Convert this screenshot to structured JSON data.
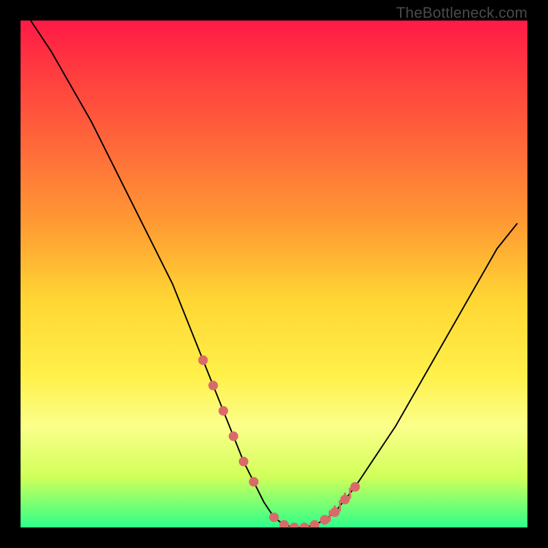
{
  "watermark": "TheBottleneck.com",
  "chart_data": {
    "type": "line",
    "title": "",
    "xlabel": "",
    "ylabel": "",
    "xlim": [
      0,
      100
    ],
    "ylim": [
      0,
      100
    ],
    "series": [
      {
        "name": "bottleneck-curve",
        "x": [
          2,
          6,
          10,
          14,
          18,
          22,
          26,
          30,
          34,
          36,
          38,
          40,
          42,
          44,
          46,
          48,
          50,
          52,
          54,
          56,
          58,
          60,
          62,
          66,
          70,
          74,
          78,
          82,
          86,
          90,
          94,
          98
        ],
        "y": [
          100,
          94,
          87,
          80,
          72,
          64,
          56,
          48,
          38,
          33,
          28,
          23,
          18,
          13,
          9,
          5,
          2,
          0.5,
          0,
          0,
          0.5,
          1.5,
          3,
          8,
          14,
          20,
          27,
          34,
          41,
          48,
          55,
          60
        ]
      }
    ],
    "markers": {
      "left_cluster_x": [
        36,
        38,
        40,
        42,
        44,
        46
      ],
      "left_cluster_y": [
        33,
        28,
        23,
        18,
        13,
        9
      ],
      "bottom_cluster_x": [
        50,
        52,
        54,
        56,
        58,
        60
      ],
      "bottom_cluster_y": [
        2,
        0.5,
        0,
        0,
        0.5,
        1.5
      ],
      "right_cluster_x": [
        60,
        62,
        64,
        66
      ],
      "right_cluster_y": [
        1.5,
        3,
        5.5,
        8
      ],
      "accent_ticks_x": [
        61,
        62,
        63,
        64,
        65
      ],
      "accent_ticks_y": [
        2,
        3,
        4,
        5.5,
        6.5
      ]
    },
    "colors": {
      "gradient_top": "#ff1a47",
      "gradient_bottom": "#2eff8a",
      "curve": "#000000",
      "markers": "#d96a6a",
      "frame": "#000000"
    }
  }
}
